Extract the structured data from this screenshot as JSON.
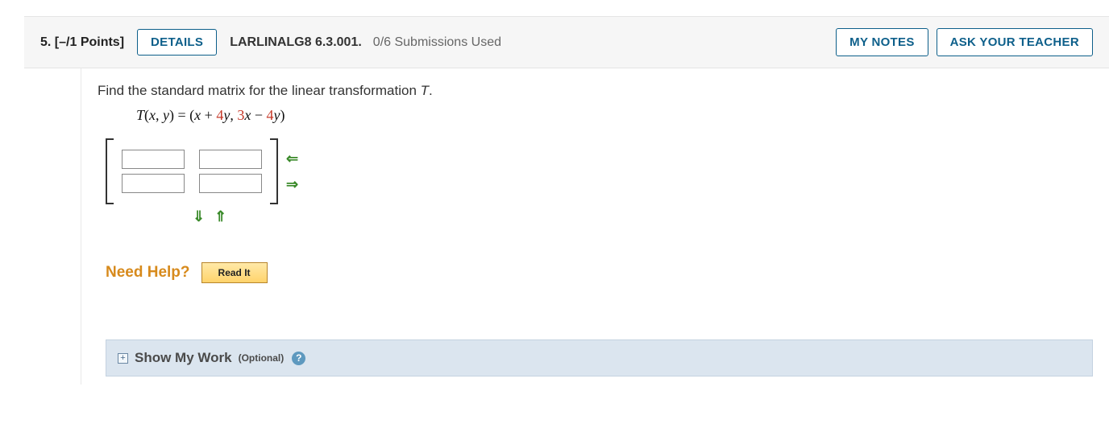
{
  "header": {
    "question_number": "5.",
    "points": "[–/1 Points]",
    "details_label": "DETAILS",
    "code": "LARLINALG8 6.3.001.",
    "submissions": "0/6 Submissions Used",
    "my_notes_label": "MY NOTES",
    "ask_teacher_label": "ASK YOUR TEACHER"
  },
  "problem": {
    "prompt_prefix": "Find the standard matrix for the linear transformation ",
    "prompt_var": "T",
    "prompt_suffix": ".",
    "formula": {
      "lhs_T": "T",
      "lhs_open": "(",
      "x": "x",
      "comma1": ", ",
      "y": "y",
      "lhs_close": ") = (",
      "term_x1": "x",
      "plus": " + ",
      "coef4a": "4",
      "term_y1": "y",
      "sep": ", ",
      "coef3": "3",
      "term_x2": "x",
      "minus": " − ",
      "coef4b": "4",
      "term_y2": "y",
      "close": ")"
    }
  },
  "matrix": {
    "values": {
      "r0c0": "",
      "r0c1": "",
      "r1c0": "",
      "r1c1": ""
    }
  },
  "help": {
    "label": "Need Help?",
    "read_it": "Read It"
  },
  "show_work": {
    "title": "Show My Work",
    "optional": "(Optional)"
  },
  "icons": {
    "plus": "+",
    "question": "?",
    "arrow_left": "⇐",
    "arrow_right": "⇒",
    "arrow_down": "⇓",
    "arrow_up": "⇑"
  }
}
